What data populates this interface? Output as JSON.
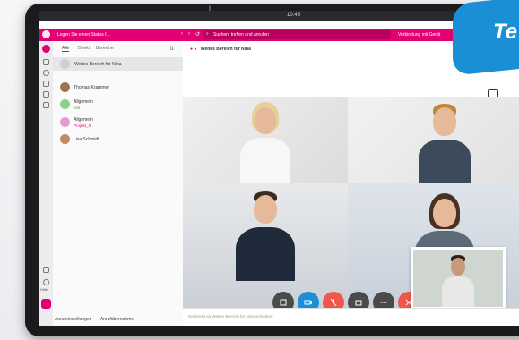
{
  "status_bar": {
    "time": "10:45"
  },
  "app": {
    "status_prompt": "Legen Sie einen Status f...",
    "search_placeholder": "Suchen, treffen und anrufen",
    "connection": "Verbindung mit Gerät",
    "accent_color": "#e20074"
  },
  "contacts": {
    "tabs": [
      "Alle",
      "Direkt",
      "Bereiche"
    ],
    "items": [
      {
        "name": "Weites Bereich für Nina",
        "sub": ""
      },
      {
        "name": "Thomas Krammer",
        "sub": ""
      },
      {
        "name": "Allgemein",
        "sub": "test"
      },
      {
        "name": "Allgemein",
        "sub": "Projekt_X"
      },
      {
        "name": "Lisa Schmidt",
        "sub": ""
      }
    ]
  },
  "conversation": {
    "title": "Weites Bereich für Nina",
    "composer_placeholder": "Nachricht an Weites Bereich für Nina schreiben"
  },
  "rail": {
    "help_label": "Hilfe"
  },
  "bottom_bar": {
    "call_settings": "Anrufeinstellungen",
    "call_pickup": "Anrufübernahme"
  },
  "badge": {
    "text": "Te"
  },
  "controls": [
    "grid-icon",
    "camera-icon",
    "mic-off-icon",
    "share-icon",
    "more-icon",
    "hangup-icon"
  ]
}
